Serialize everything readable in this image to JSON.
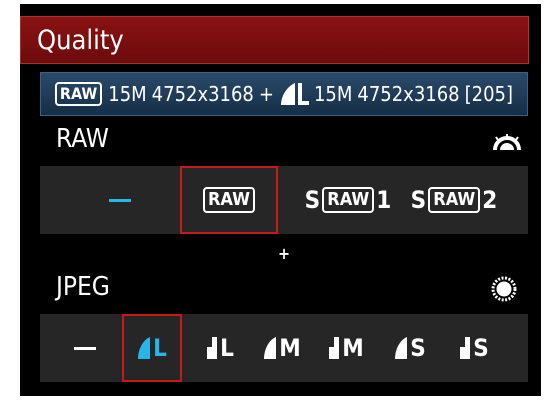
{
  "header": {
    "title": "Quality"
  },
  "summary": {
    "raw_badge": "RAW",
    "raw_mp": "15M",
    "raw_dims": "4752x3168",
    "plus": "+",
    "jpeg_mp": "15M",
    "jpeg_dims": "4752x3168",
    "shots_remaining": "[205]"
  },
  "raw_section": {
    "label": "RAW",
    "dial_icon": "main-dial-icon",
    "options": [
      {
        "label": "—",
        "selected": false
      },
      {
        "label": "RAW",
        "selected": true
      },
      {
        "prefix": "S",
        "badge": "RAW",
        "suffix": "1",
        "selected": false
      },
      {
        "prefix": "S",
        "badge": "RAW",
        "suffix": "2",
        "selected": false
      }
    ]
  },
  "plus_sign": "+",
  "jpeg_section": {
    "label": "JPEG",
    "dial_icon": "quick-control-dial-icon",
    "options": [
      {
        "label": "—",
        "selected": false
      },
      {
        "icon": "fine-quality-icon",
        "size": "L",
        "selected": true
      },
      {
        "icon": "normal-quality-icon",
        "size": "L",
        "selected": false
      },
      {
        "icon": "fine-quality-icon",
        "size": "M",
        "selected": false
      },
      {
        "icon": "normal-quality-icon",
        "size": "M",
        "selected": false
      },
      {
        "icon": "fine-quality-icon",
        "size": "S",
        "selected": false
      },
      {
        "icon": "normal-quality-icon",
        "size": "S",
        "selected": false
      }
    ]
  },
  "colors": {
    "accent_blue": "#29b6e6",
    "selection_red": "#c41a1a",
    "title_red": "#7a0e0e",
    "summary_blue": "#1f3d5c"
  }
}
